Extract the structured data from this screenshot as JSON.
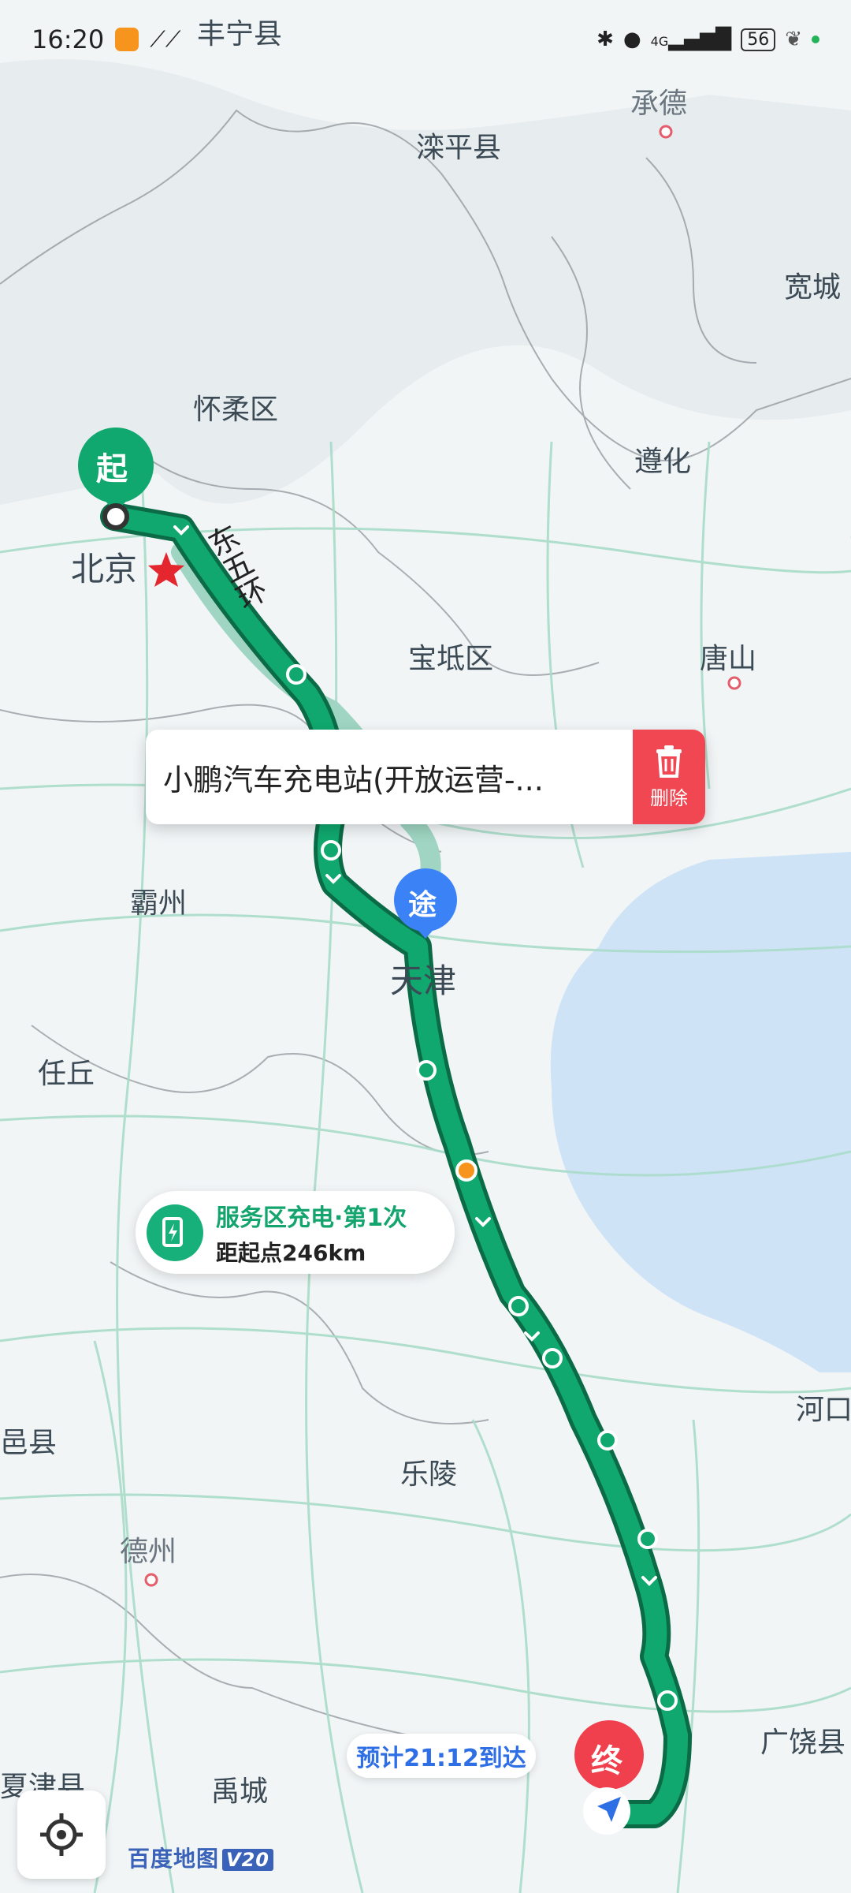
{
  "status_bar": {
    "time": "16:20",
    "network": "4G",
    "battery": "56"
  },
  "map_labels": {
    "fengning": "丰宁县",
    "chengde": "承德",
    "luanping": "滦平县",
    "kuancheng": "宽城",
    "huairou": "怀柔区",
    "zunhua": "遵化",
    "beijing": "北京",
    "road": "东五环",
    "baodi": "宝坻区",
    "tangshan": "唐山",
    "bazhou": "霸州",
    "tianjin": "天津",
    "renqiu": "任丘",
    "yixian": "邑县",
    "hekou": "河口",
    "leling": "乐陵",
    "dezhou": "德州",
    "xiajin": "夏津县",
    "yucheng": "禹城",
    "guangrao": "广饶县"
  },
  "markers": {
    "start": "起",
    "via": "途",
    "end": "终"
  },
  "popup": {
    "station_name": "小鹏汽车充电站(开放运营-...",
    "delete_label": "删除"
  },
  "charging_card": {
    "title": "服务区充电·第1次",
    "distance": "距起点246km"
  },
  "eta": "预计21:12到达",
  "logo": {
    "name": "百度地图",
    "version": "V20"
  },
  "colors": {
    "route": "#10a86e",
    "route_dark": "#0b6b47",
    "alt_route": "#9fd5c2",
    "sea": "#cfe3f7",
    "end_marker": "#f0404e",
    "via_marker": "#3b82f6"
  }
}
